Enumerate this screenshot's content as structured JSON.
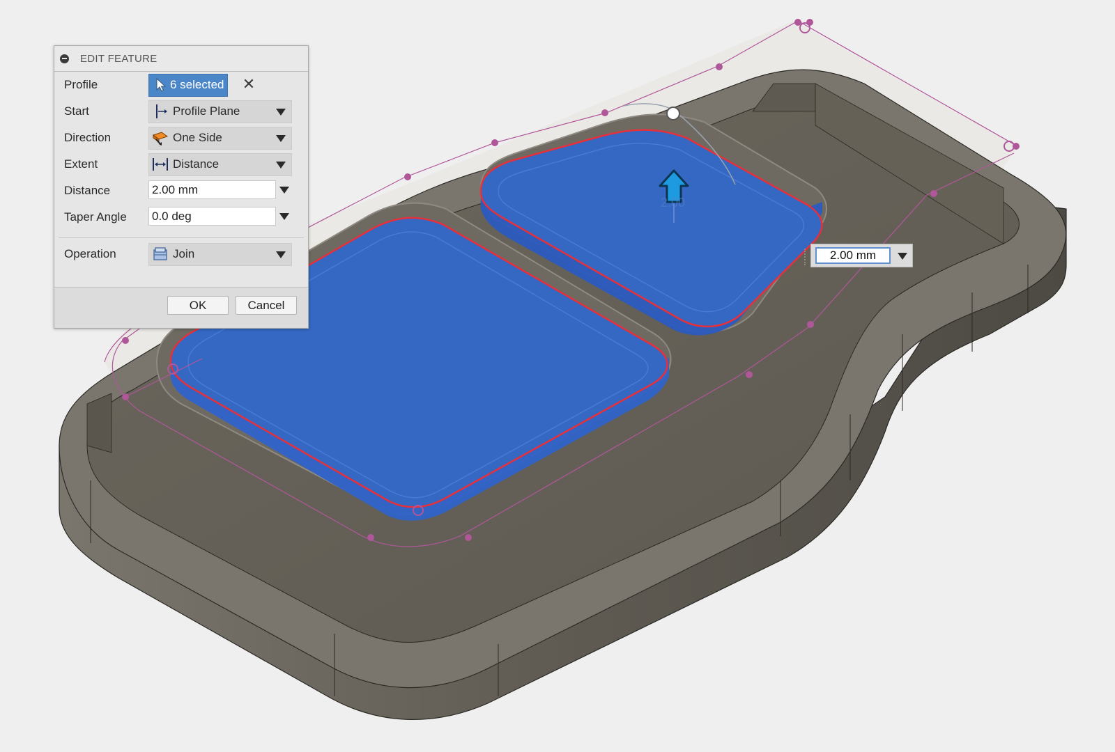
{
  "dialog": {
    "title": "EDIT FEATURE",
    "fields": {
      "profile": {
        "label": "Profile",
        "value": "6 selected",
        "icon": "cursor-select-icon"
      },
      "start": {
        "label": "Start",
        "value": "Profile Plane",
        "icon": "profile-plane-icon"
      },
      "direction": {
        "label": "Direction",
        "value": "One Side",
        "icon": "one-side-direction-icon"
      },
      "extent": {
        "label": "Extent",
        "value": "Distance",
        "icon": "distance-extent-icon"
      },
      "distance": {
        "label": "Distance",
        "value": "2.00 mm"
      },
      "taper": {
        "label": "Taper Angle",
        "value": "0.0 deg"
      },
      "operation": {
        "label": "Operation",
        "value": "Join",
        "icon": "join-body-icon"
      }
    },
    "ok_label": "OK",
    "cancel_label": "Cancel"
  },
  "canvas": {
    "dimension_input": "2.00 mm",
    "ghost_dimension": "2.00"
  },
  "colors": {
    "selection_blue": "#2f63c9",
    "profile_highlight": "#e8303a",
    "sketch_line": "#b0579a",
    "body_gray": "#6b665e",
    "manipulator": "#1e9be0"
  }
}
